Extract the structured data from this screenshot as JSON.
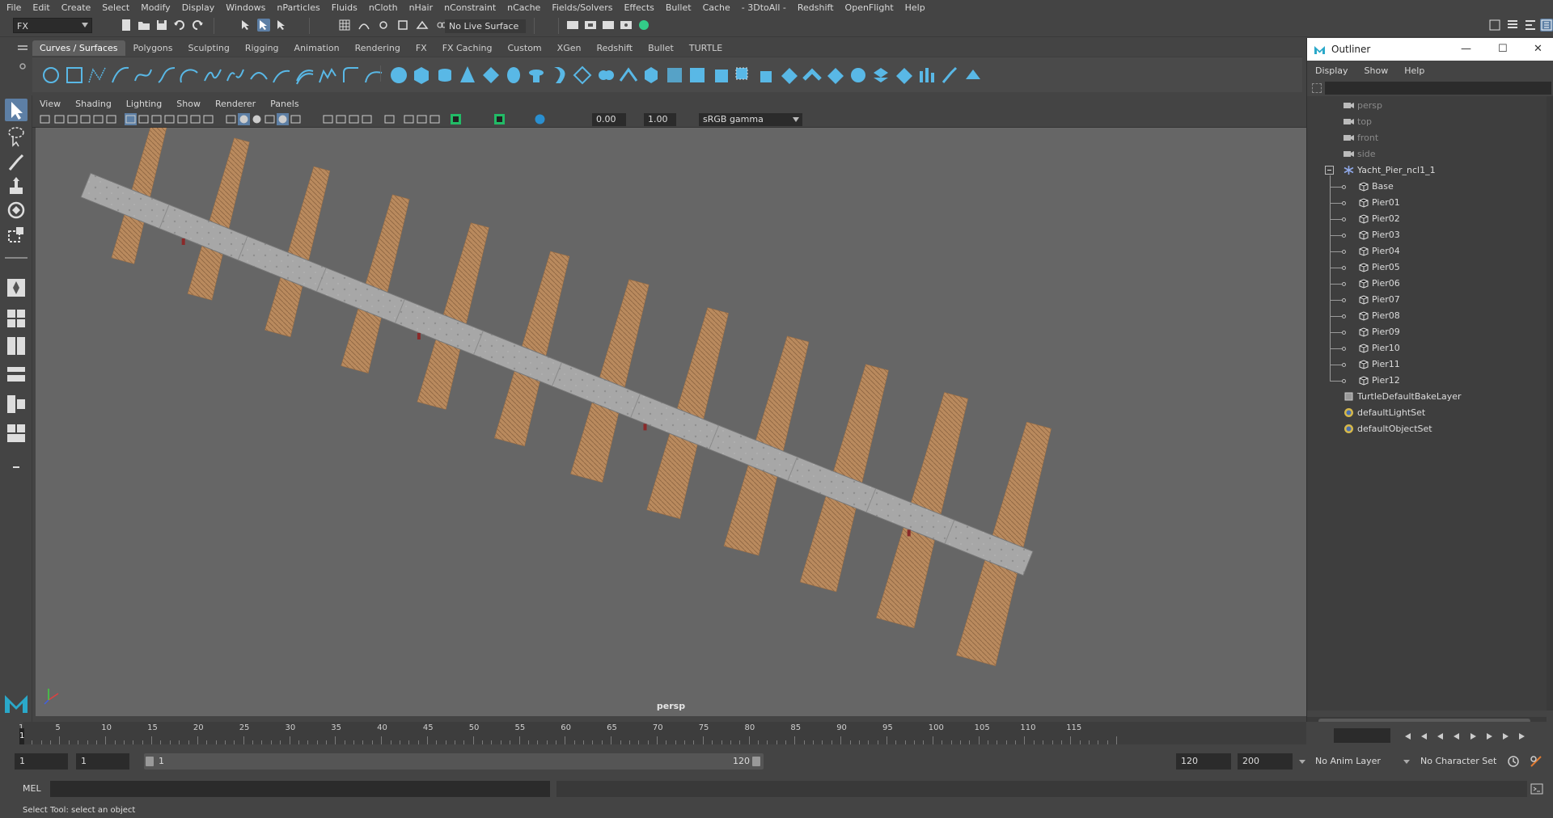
{
  "menubar": [
    "File",
    "Edit",
    "Create",
    "Select",
    "Modify",
    "Display",
    "Windows",
    "nParticles",
    "Fluids",
    "nCloth",
    "nHair",
    "nConstraint",
    "nCache",
    "Fields/Solvers",
    "Effects",
    "Bullet",
    "Cache",
    "- 3DtoAll -",
    "Redshift",
    "OpenFlight",
    "Help"
  ],
  "status": {
    "mode": "FX",
    "live_surface": "No Live Surface"
  },
  "shelf": {
    "tabs": [
      "Curves / Surfaces",
      "Polygons",
      "Sculpting",
      "Rigging",
      "Animation",
      "Rendering",
      "FX",
      "FX Caching",
      "Custom",
      "XGen",
      "Redshift",
      "Bullet",
      "TURTLE"
    ],
    "active_tab": "Curves / Surfaces"
  },
  "viewport": {
    "menu": [
      "View",
      "Shading",
      "Lighting",
      "Show",
      "Renderer",
      "Panels"
    ],
    "exposure": "0.00",
    "gamma": "1.00",
    "color_space": "sRGB gamma",
    "camera": "persp"
  },
  "outliner": {
    "title": "Outliner",
    "menu": [
      "Display",
      "Show",
      "Help"
    ],
    "items": [
      {
        "label": "persp",
        "kind": "camera",
        "depth": 0,
        "dim": true
      },
      {
        "label": "top",
        "kind": "camera",
        "depth": 0,
        "dim": true
      },
      {
        "label": "front",
        "kind": "camera",
        "depth": 0,
        "dim": true
      },
      {
        "label": "side",
        "kind": "camera",
        "depth": 0,
        "dim": true
      },
      {
        "label": "Yacht_Pier_ncl1_1",
        "kind": "group",
        "depth": 0,
        "expanded": true
      },
      {
        "label": "Base",
        "kind": "mesh",
        "depth": 1
      },
      {
        "label": "Pier01",
        "kind": "mesh",
        "depth": 1
      },
      {
        "label": "Pier02",
        "kind": "mesh",
        "depth": 1
      },
      {
        "label": "Pier03",
        "kind": "mesh",
        "depth": 1
      },
      {
        "label": "Pier04",
        "kind": "mesh",
        "depth": 1
      },
      {
        "label": "Pier05",
        "kind": "mesh",
        "depth": 1
      },
      {
        "label": "Pier06",
        "kind": "mesh",
        "depth": 1
      },
      {
        "label": "Pier07",
        "kind": "mesh",
        "depth": 1
      },
      {
        "label": "Pier08",
        "kind": "mesh",
        "depth": 1
      },
      {
        "label": "Pier09",
        "kind": "mesh",
        "depth": 1
      },
      {
        "label": "Pier10",
        "kind": "mesh",
        "depth": 1
      },
      {
        "label": "Pier11",
        "kind": "mesh",
        "depth": 1
      },
      {
        "label": "Pier12",
        "kind": "mesh",
        "depth": 1
      },
      {
        "label": "TurtleDefaultBakeLayer",
        "kind": "layer",
        "depth": 0
      },
      {
        "label": "defaultLightSet",
        "kind": "set",
        "depth": 0
      },
      {
        "label": "defaultObjectSet",
        "kind": "set",
        "depth": 0
      }
    ]
  },
  "timeline": {
    "ticks": [
      1,
      5,
      10,
      15,
      20,
      25,
      30,
      35,
      40,
      45,
      50,
      55,
      60,
      65,
      70,
      75,
      80,
      85,
      90,
      95,
      100,
      105,
      110,
      115
    ],
    "current_frame": "1"
  },
  "range": {
    "start": "1",
    "playback_start": "1",
    "bar_start": "1",
    "bar_end": "120",
    "playback_end": "120",
    "end": "200",
    "anim_layer": "No Anim Layer",
    "character_set": "No Character Set"
  },
  "command": {
    "label": "MEL"
  },
  "help_text": "Select Tool: select an object",
  "colors": {
    "accent": "#5d7fa5",
    "shelf_icon": "#59b8e6",
    "pier_wood": "#b98a5e",
    "walkway": "#a7a7a7",
    "viewport_bg": "#666666"
  }
}
